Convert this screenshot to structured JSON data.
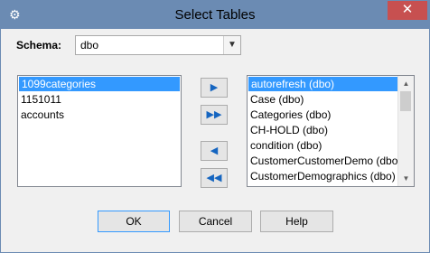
{
  "window": {
    "title": "Select Tables",
    "close_label": "✕"
  },
  "schema": {
    "label": "Schema:",
    "value": "dbo"
  },
  "left_list": {
    "items": [
      "1099categories",
      "1151011",
      "accounts"
    ],
    "selected_index": 0
  },
  "right_list": {
    "items": [
      "autorefresh (dbo)",
      "Case (dbo)",
      "Categories (dbo)",
      "CH-HOLD (dbo)",
      "condition (dbo)",
      "CustomerCustomerDemo (dbo)",
      "CustomerDemographics (dbo)"
    ],
    "selected_index": 0
  },
  "move_buttons": {
    "add": "▶",
    "add_all": "▶▶",
    "remove": "◀",
    "remove_all": "◀◀"
  },
  "buttons": {
    "ok": "OK",
    "cancel": "Cancel",
    "help": "Help"
  },
  "colors": {
    "titlebar": "#6b8bb3",
    "selection": "#3399ff",
    "close": "#c75050",
    "arrow": "#1565c0"
  }
}
